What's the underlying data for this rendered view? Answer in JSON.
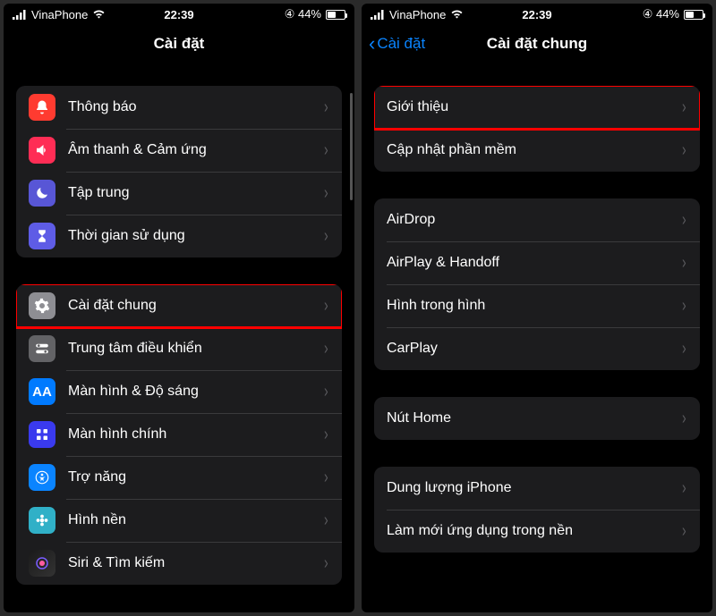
{
  "status": {
    "carrier": "VinaPhone",
    "time": "22:39",
    "battery_pct": "44%"
  },
  "left": {
    "title": "Cài đặt",
    "group1": [
      {
        "label": "Thông báo"
      },
      {
        "label": "Âm thanh & Cảm ứng"
      },
      {
        "label": "Tập trung"
      },
      {
        "label": "Thời gian sử dụng"
      }
    ],
    "group2": [
      {
        "label": "Cài đặt chung",
        "highlight": true
      },
      {
        "label": "Trung tâm điều khiển"
      },
      {
        "label": "Màn hình & Độ sáng"
      },
      {
        "label": "Màn hình chính"
      },
      {
        "label": "Trợ năng"
      },
      {
        "label": "Hình nền"
      },
      {
        "label": "Siri & Tìm kiếm"
      }
    ]
  },
  "right": {
    "back": "Cài đặt",
    "title": "Cài đặt chung",
    "group1": [
      {
        "label": "Giới thiệu",
        "highlight": true
      },
      {
        "label": "Cập nhật phần mềm"
      }
    ],
    "group2": [
      {
        "label": "AirDrop"
      },
      {
        "label": "AirPlay & Handoff"
      },
      {
        "label": "Hình trong hình"
      },
      {
        "label": "CarPlay"
      }
    ],
    "group3": [
      {
        "label": "Nút Home"
      }
    ],
    "group4": [
      {
        "label": "Dung lượng iPhone"
      },
      {
        "label": "Làm mới ứng dụng trong nền"
      }
    ]
  }
}
